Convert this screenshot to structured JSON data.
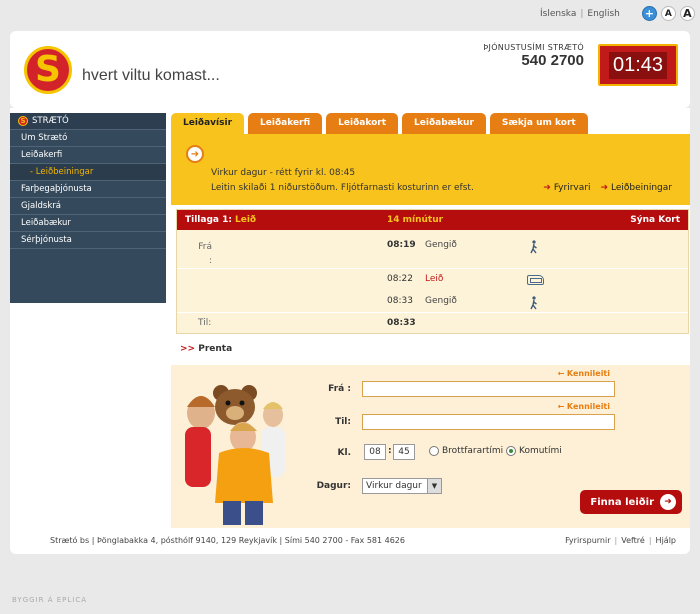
{
  "toplinks": {
    "lang1": "Íslenska",
    "lang2": "English",
    "plus": "+",
    "font_a": "A",
    "font_a_big": "A"
  },
  "header": {
    "logo_letter": "S",
    "tagline": "hvert viltu komast...",
    "service_label": "ÞJÓNUSTUSÍMI STRÆTÓ",
    "service_phone": "540 2700",
    "clock": "01:43"
  },
  "sidebar": {
    "items": [
      "STRÆTÓ",
      "Um Strætó",
      "Leiðakerfi",
      "- Leiðbeiningar",
      "Farþegaþjónusta",
      "Gjaldskrá",
      "Leiðabækur",
      "Sérþjónusta"
    ]
  },
  "tabs": [
    "Leiðavísir",
    "Leiðakerfi",
    "Leiðakort",
    "Leiðabækur",
    "Sækja um kort"
  ],
  "info": {
    "line1": "Virkur dagur - rétt fyrir kl. 08:45",
    "line2": "Leitin skilaði 1 niðurstöðum. Fljótfarnasti kosturinn er efst.",
    "link1": "Fyrirvari",
    "link2": "Leiðbeiningar"
  },
  "result": {
    "option": "Tillaga 1:",
    "route_label": "Leið",
    "duration": "14 mínútur",
    "map_link": "Sýna Kort",
    "rows": [
      {
        "label": "Frá :",
        "time": "08:19",
        "desc": "Gengið"
      },
      {
        "label": "",
        "time": "08:22",
        "desc": "Leið"
      },
      {
        "label": "",
        "time": "08:33",
        "desc": "Gengið"
      },
      {
        "label": "Til:",
        "time": "08:33",
        "desc": ""
      }
    ]
  },
  "print": {
    "arrows": ">>",
    "label": "Prenta"
  },
  "form": {
    "from_label": "Frá :",
    "to_label": "Til:",
    "time_label": "Kl.",
    "day_label": "Dagur:",
    "landmark": "Kennileiti",
    "hour": "08",
    "minute": "45",
    "radio_depart": "Brottfarartími",
    "radio_arrive": "Komutími",
    "day_value": "Virkur dagur",
    "submit": "Finna leiðir"
  },
  "footer": {
    "address": "Strætó bs | Þönglabakka 4, pósthólf 9140, 129 Reykjavík | Sími 540 2700 - Fax 581 4626",
    "link1": "Fyrirspurnir",
    "link2": "Veftré",
    "link3": "Hjálp"
  },
  "credit": "BYGGIR Á EPLICA"
}
